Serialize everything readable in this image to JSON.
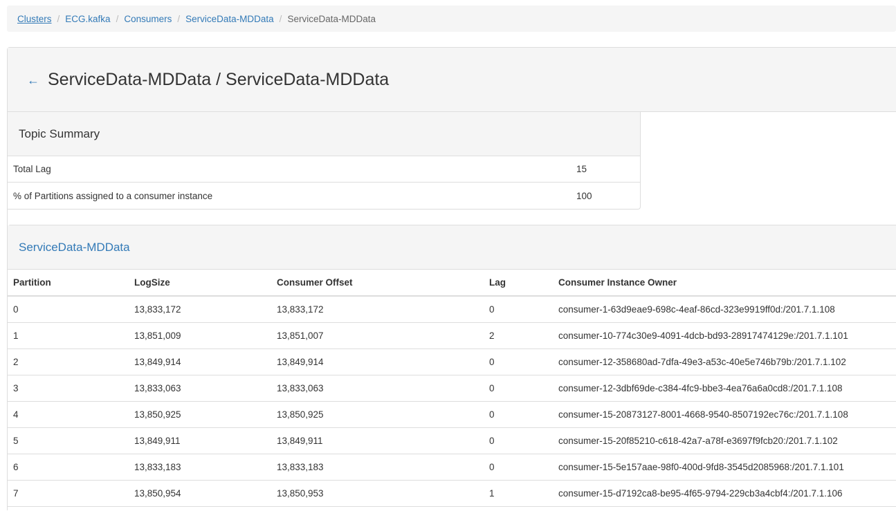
{
  "breadcrumb": {
    "items": [
      "Clusters",
      "ECG.kafka",
      "Consumers",
      "ServiceData-MDData"
    ],
    "active": "ServiceData-MDData",
    "separator": "/"
  },
  "header": {
    "back_icon": "←",
    "title": "ServiceData-MDData / ServiceData-MDData"
  },
  "summary": {
    "heading": "Topic Summary",
    "rows": [
      {
        "label": "Total Lag",
        "value": "15"
      },
      {
        "label": "% of Partitions assigned to a consumer instance",
        "value": "100"
      }
    ]
  },
  "consumer_table": {
    "heading": "ServiceData-MDData",
    "columns": [
      "Partition",
      "LogSize",
      "Consumer Offset",
      "Lag",
      "Consumer Instance Owner"
    ],
    "rows": [
      [
        "0",
        "13,833,172",
        "13,833,172",
        "0",
        "consumer-1-63d9eae9-698c-4eaf-86cd-323e9919ff0d:/201.7.1.108"
      ],
      [
        "1",
        "13,851,009",
        "13,851,007",
        "2",
        "consumer-10-774c30e9-4091-4dcb-bd93-28917474129e:/201.7.1.101"
      ],
      [
        "2",
        "13,849,914",
        "13,849,914",
        "0",
        "consumer-12-358680ad-7dfa-49e3-a53c-40e5e746b79b:/201.7.1.102"
      ],
      [
        "3",
        "13,833,063",
        "13,833,063",
        "0",
        "consumer-12-3dbf69de-c384-4fc9-bbe3-4ea76a6a0cd8:/201.7.1.108"
      ],
      [
        "4",
        "13,850,925",
        "13,850,925",
        "0",
        "consumer-15-20873127-8001-4668-9540-8507192ec76c:/201.7.1.108"
      ],
      [
        "5",
        "13,849,911",
        "13,849,911",
        "0",
        "consumer-15-20f85210-c618-42a7-a78f-e3697f9fcb20:/201.7.1.102"
      ],
      [
        "6",
        "13,833,183",
        "13,833,183",
        "0",
        "consumer-15-5e157aae-98f0-400d-9fd8-3545d2085968:/201.7.1.101"
      ],
      [
        "7",
        "13,850,954",
        "13,850,953",
        "1",
        "consumer-15-d7192ca8-be95-4f65-9794-229cb3a4cbf4:/201.7.1.106"
      ]
    ]
  },
  "colors": {
    "link": "#337ab7",
    "panel_bg": "#f5f5f5",
    "border": "#dddddd",
    "text": "#333333"
  }
}
